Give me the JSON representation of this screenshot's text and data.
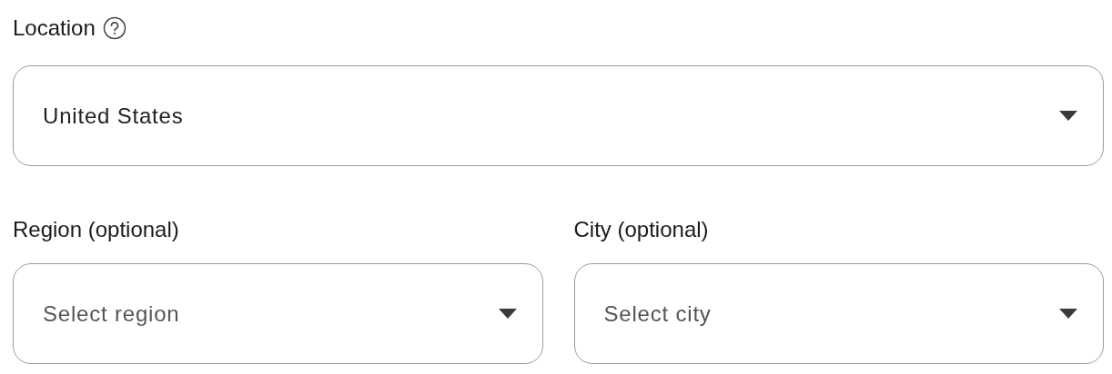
{
  "location": {
    "label": "Location",
    "value": "United States"
  },
  "fields": [
    {
      "label": "Region (optional)",
      "placeholder": "Select region"
    },
    {
      "label": "City (optional)",
      "placeholder": "Select city"
    }
  ]
}
